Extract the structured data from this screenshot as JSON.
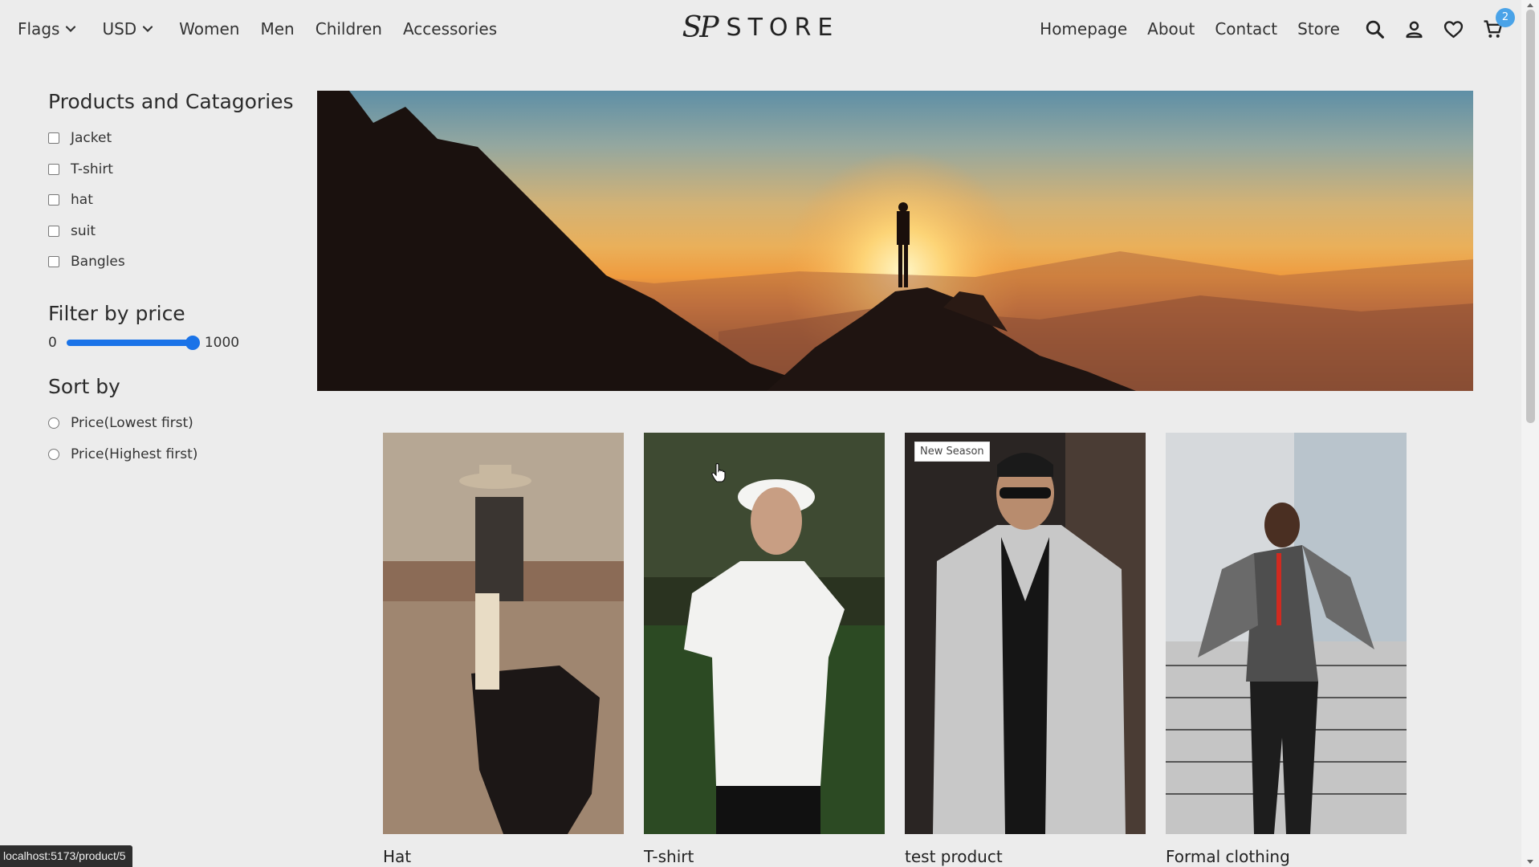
{
  "header": {
    "flags_label": "Flags",
    "currency_label": "USD",
    "categories": [
      "Women",
      "Men",
      "Children",
      "Accessories"
    ],
    "logo_mark": "SP",
    "logo_text": "STORE",
    "nav": [
      "Homepage",
      "About",
      "Contact",
      "Store"
    ],
    "cart_count": "2"
  },
  "sidebar": {
    "categories_title": "Products and Catagories",
    "categories": [
      "Jacket",
      "T-shirt",
      "hat",
      "suit",
      "Bangles"
    ],
    "price_title": "Filter by price",
    "price_min": "0",
    "price_max": "1000",
    "sort_title": "Sort by",
    "sort_options": [
      "Price(Lowest first)",
      "Price(Highest first)"
    ]
  },
  "products": [
    {
      "name": "Hat"
    },
    {
      "name": "T-shirt"
    },
    {
      "name": "test product",
      "tag": "New Season"
    },
    {
      "name": "Formal clothing"
    }
  ],
  "status_url": "localhost:5173/product/5",
  "colors": {
    "accent": "#1a73e8",
    "badge": "#4aa3e8",
    "background": "#ececec"
  }
}
